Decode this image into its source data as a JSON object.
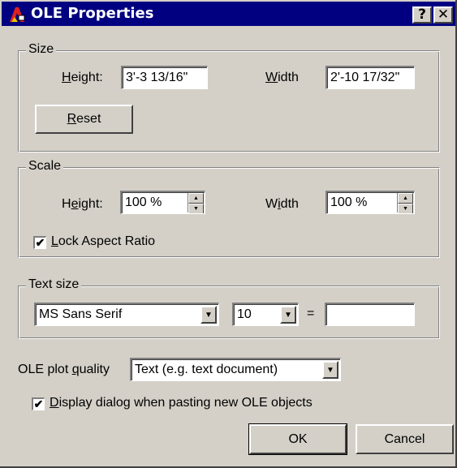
{
  "window": {
    "title": "OLE Properties",
    "help_button": "?",
    "close_button": "✕"
  },
  "size": {
    "legend": "Size",
    "height_label_u": "H",
    "height_label_rest": "eight:",
    "height_value": "3'-3 13/16\"",
    "width_label_u": "W",
    "width_label_rest": "idth",
    "width_value": "2'-10 17/32\"",
    "reset_u": "R",
    "reset_rest": "eset"
  },
  "scale": {
    "legend": "Scale",
    "height_label_pre": "H",
    "height_label_u": "e",
    "height_label_rest": "ight:",
    "height_value": "100 %",
    "width_label_pre": "W",
    "width_label_u": "i",
    "width_label_rest": "dth",
    "width_value": "100 %",
    "lock_u": "L",
    "lock_rest": "ock Aspect Ratio",
    "lock_checked": "✔"
  },
  "text_size": {
    "legend": "Text size",
    "font_value": "MS Sans Serif",
    "size_value": "10",
    "equals": "=",
    "custom_value": ""
  },
  "plot_quality": {
    "label_pre": "OLE plot ",
    "label_u": "q",
    "label_rest": "uality",
    "value": "Text (e.g. text document)"
  },
  "display_dialog": {
    "label_u": "D",
    "label_rest": "isplay dialog when pasting new OLE objects",
    "checked": "✔"
  },
  "buttons": {
    "ok": "OK",
    "cancel": "Cancel"
  },
  "icons": {
    "dropdown": "▼",
    "spin_up": "▲",
    "spin_down": "▼"
  }
}
